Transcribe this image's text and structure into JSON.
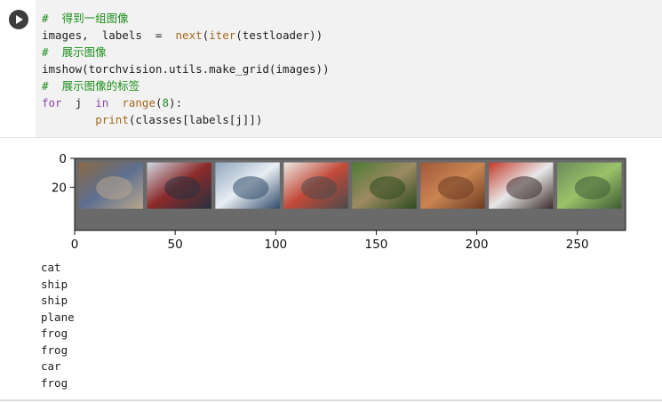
{
  "code": {
    "lines": [
      {
        "parts": [
          {
            "t": "#  得到一组图像",
            "c": "cm"
          }
        ]
      },
      {
        "parts": [
          {
            "t": "images,  labels  =  ",
            "c": "op"
          },
          {
            "t": "next",
            "c": "fn"
          },
          {
            "t": "(",
            "c": "op"
          },
          {
            "t": "iter",
            "c": "fn"
          },
          {
            "t": "(testloader))",
            "c": "op"
          }
        ]
      },
      {
        "parts": [
          {
            "t": "#  展示图像",
            "c": "cm"
          }
        ]
      },
      {
        "parts": [
          {
            "t": "imshow(torchvision.utils.make_grid(images))",
            "c": "op"
          }
        ]
      },
      {
        "parts": [
          {
            "t": "#  展示图像的标签",
            "c": "cm"
          }
        ]
      },
      {
        "parts": [
          {
            "t": "for",
            "c": "kw"
          },
          {
            "t": "  j  ",
            "c": "op"
          },
          {
            "t": "in",
            "c": "kw"
          },
          {
            "t": "  ",
            "c": "op"
          },
          {
            "t": "range",
            "c": "fn"
          },
          {
            "t": "(",
            "c": "op"
          },
          {
            "t": "8",
            "c": "num"
          },
          {
            "t": "):",
            "c": "op"
          }
        ]
      },
      {
        "parts": [
          {
            "t": "        ",
            "c": "op"
          },
          {
            "t": "print",
            "c": "fn"
          },
          {
            "t": "(classes[labels[j]])",
            "c": "op"
          }
        ]
      }
    ]
  },
  "plot": {
    "x_ticks": [
      "0",
      "50",
      "100",
      "150",
      "200",
      "250"
    ],
    "y_ticks": [
      "0",
      "20"
    ],
    "images": [
      {
        "label": "cat",
        "colors": [
          "#8a6a44",
          "#5d6f8f",
          "#b9a78e"
        ]
      },
      {
        "label": "ship",
        "colors": [
          "#cfd9e2",
          "#8b2a2a",
          "#26323f"
        ]
      },
      {
        "label": "ship",
        "colors": [
          "#8fa6bd",
          "#e8eef3",
          "#2f4a6a"
        ]
      },
      {
        "label": "plane",
        "colors": [
          "#ede9e4",
          "#c24a3a",
          "#4a4a4a"
        ]
      },
      {
        "label": "frog",
        "colors": [
          "#4f7a33",
          "#9c8a62",
          "#2c4a1e"
        ]
      },
      {
        "label": "frog",
        "colors": [
          "#a0593a",
          "#c98552",
          "#6b3a22"
        ]
      },
      {
        "label": "car",
        "colors": [
          "#c23a2a",
          "#e8e8e8",
          "#3a2a2a"
        ]
      },
      {
        "label": "frog",
        "colors": [
          "#6c8a5a",
          "#9ac36a",
          "#3e5a34"
        ]
      }
    ]
  },
  "output": [
    "cat",
    "ship",
    "ship",
    "plane",
    "frog",
    "frog",
    "car",
    "frog"
  ]
}
